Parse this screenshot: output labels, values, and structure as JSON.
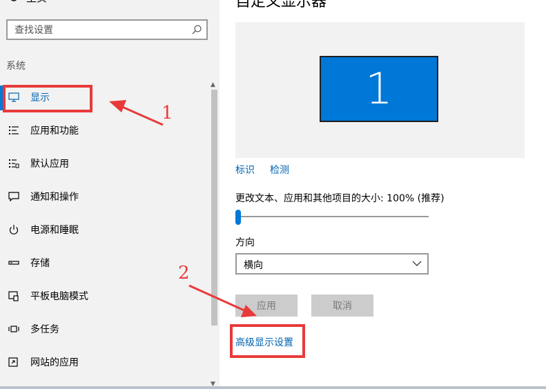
{
  "sidebar": {
    "home_label": "主页",
    "search": {
      "placeholder": "查找设置",
      "value": ""
    },
    "section_label": "系统",
    "items": [
      {
        "label": "显示",
        "icon": "monitor-icon",
        "active": true
      },
      {
        "label": "应用和功能",
        "icon": "apps-list-icon"
      },
      {
        "label": "默认应用",
        "icon": "default-apps-icon"
      },
      {
        "label": "通知和操作",
        "icon": "notification-icon"
      },
      {
        "label": "电源和睡眠",
        "icon": "power-icon"
      },
      {
        "label": "存储",
        "icon": "storage-icon"
      },
      {
        "label": "平板电脑模式",
        "icon": "tablet-mode-icon"
      },
      {
        "label": "多任务",
        "icon": "multitask-icon"
      },
      {
        "label": "网站的应用",
        "icon": "web-apps-icon"
      }
    ]
  },
  "main": {
    "title": "自定义显示器",
    "monitor_number": "1",
    "identify_link": "标识",
    "detect_link": "检测",
    "scale_label": "更改文本、应用和其他项目的大小: 100% (推荐)",
    "scale_slider_value": 0,
    "orientation_label": "方向",
    "orientation_value": "横向",
    "apply_button": "应用",
    "cancel_button": "取消",
    "advanced_link": "高级显示设置"
  },
  "annotations": [
    {
      "number": "1"
    },
    {
      "number": "2"
    }
  ],
  "colors": {
    "accent": "#0078d7",
    "link": "#0063b1",
    "annotation": "#e83a3a",
    "sidebar_bg": "#f2f2f2"
  }
}
